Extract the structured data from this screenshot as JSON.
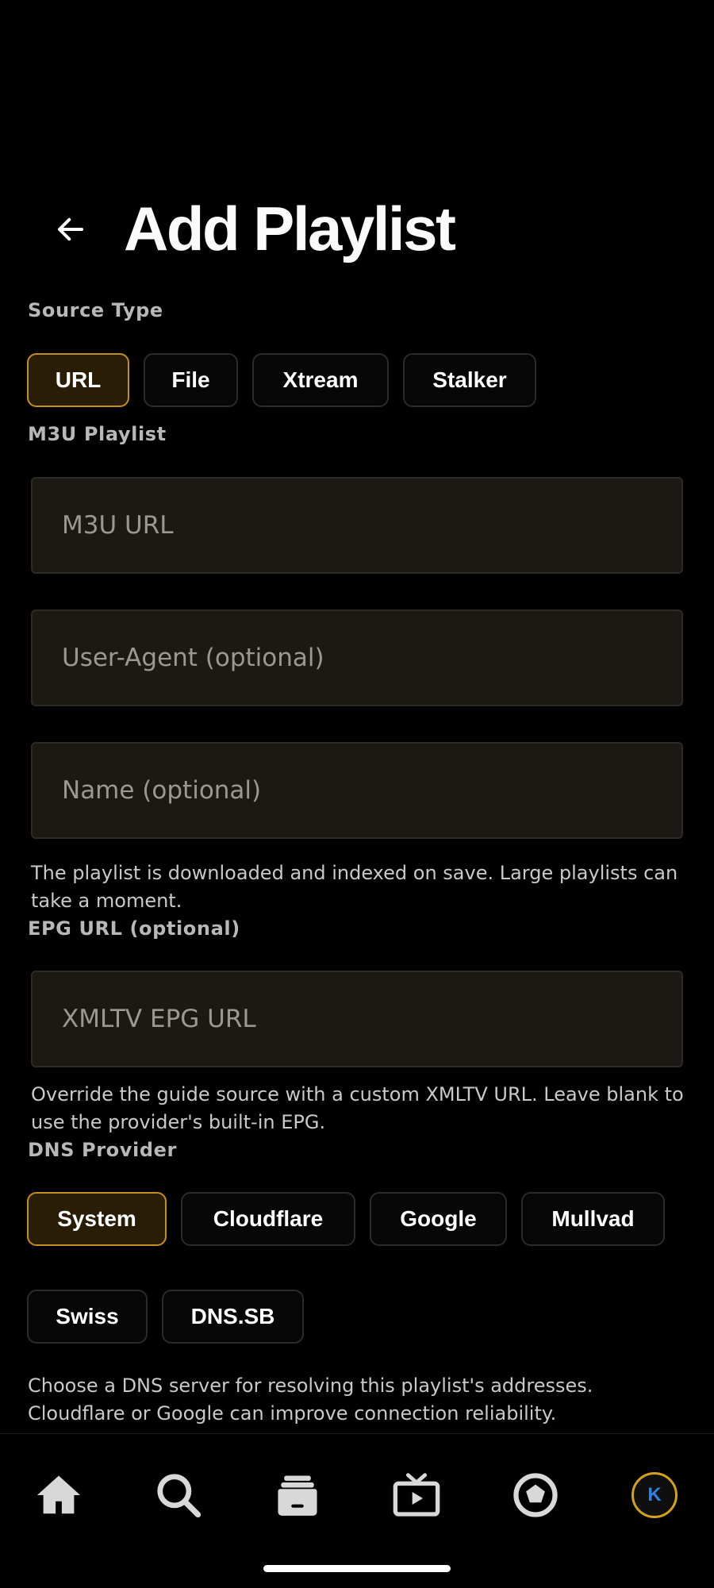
{
  "header": {
    "title": "Add Playlist",
    "back_icon": "arrow-left-icon"
  },
  "source_type": {
    "label": "Source Type",
    "options": [
      "URL",
      "File",
      "Xtream",
      "Stalker"
    ],
    "selected": "URL"
  },
  "m3u": {
    "label": "M3U Playlist",
    "url_placeholder": "M3U URL",
    "user_agent_placeholder": "User-Agent (optional)",
    "name_placeholder": "Name (optional)",
    "helper": "The playlist is downloaded and indexed on save. Large playlists can take a moment."
  },
  "epg": {
    "label": "EPG URL (optional)",
    "placeholder": "XMLTV EPG URL",
    "helper": "Override the guide source with a custom XMLTV URL. Leave blank to use the provider's built-in EPG."
  },
  "dns": {
    "label": "DNS Provider",
    "options": [
      "System",
      "Cloudflare",
      "Google",
      "Mullvad",
      "Swiss",
      "DNS.SB"
    ],
    "selected": "System",
    "helper": "Choose a DNS server for resolving this playlist's addresses. Cloudflare or Google can improve connection reliability."
  },
  "bottom_nav": {
    "items": [
      "home-icon",
      "search-icon",
      "library-icon",
      "live-tv-icon",
      "discover-icon",
      "profile-avatar"
    ],
    "avatar_initial": "K"
  },
  "colors": {
    "accent": "#c38f1f",
    "selected_chip_bg": "#2a1d05",
    "field_bg": "#1c1915",
    "avatar_border": "#d4a11d",
    "avatar_text": "#2d82e6"
  }
}
